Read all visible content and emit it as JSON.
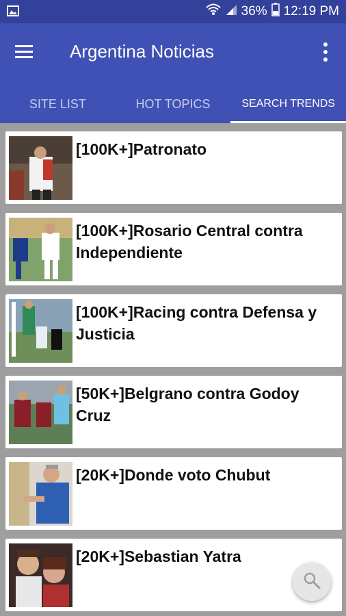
{
  "status_bar": {
    "battery_percent": "36%",
    "time": "12:19 PM",
    "icons": [
      "image-notification-icon",
      "wifi-icon",
      "signal-icon",
      "battery-icon"
    ]
  },
  "app_bar": {
    "title": "Argentina Noticias",
    "background": "#3f51b5",
    "status_background": "#33419a"
  },
  "tabs": [
    {
      "label": "SITE LIST",
      "active": false
    },
    {
      "label": "HOT TOPICS",
      "active": false
    },
    {
      "label": "SEARCH TRENDS",
      "active": true
    }
  ],
  "trends": [
    {
      "title": "[100K+]Patronato"
    },
    {
      "title": "[100K+]Rosario Central contra Independiente"
    },
    {
      "title": "[100K+]Racing contra Defensa y Justicia"
    },
    {
      "title": "[50K+]Belgrano contra Godoy Cruz"
    },
    {
      "title": "[20K+]Donde voto Chubut"
    },
    {
      "title": "[20K+]Sebastian Yatra"
    }
  ],
  "fab": {
    "icon": "search-icon"
  }
}
